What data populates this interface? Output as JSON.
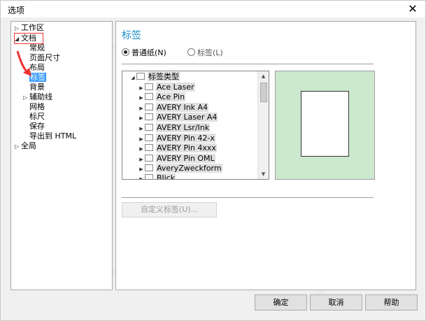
{
  "window": {
    "title": "选项",
    "close_glyph": "✕"
  },
  "tree": [
    {
      "expander": "▷",
      "label": "工作区"
    },
    {
      "expander": "◢",
      "label": "文档"
    },
    {
      "label": "常规"
    },
    {
      "label": "页面尺寸"
    },
    {
      "label": "布局"
    },
    {
      "label": "标签"
    },
    {
      "label": "背景"
    },
    {
      "expander": "▷",
      "label": "辅助线"
    },
    {
      "label": "网格"
    },
    {
      "label": "标尺"
    },
    {
      "label": "保存"
    },
    {
      "label": "导出到 HTML"
    },
    {
      "expander": "▷",
      "label": "全局"
    }
  ],
  "content": {
    "title": "标签",
    "radio_plain": "普通纸(N)",
    "radio_label": "标签(L)",
    "list_root": "标签类型",
    "list_items": [
      "Ace Laser",
      "Ace Pin",
      "AVERY Ink A4",
      "AVERY Laser A4",
      "AVERY Lsr/Ink",
      "AVERY Pin 42-x",
      "AVERY Pin 4xxx",
      "AVERY Pin OML",
      "AveryZweckform",
      "Blick"
    ],
    "custom_button": "自定义标签(U)..."
  },
  "buttons": {
    "ok": "确定",
    "cancel": "取消",
    "help": "帮助"
  },
  "colors": {
    "accent": "#1e90c8",
    "selection": "#3399ff",
    "highlight_box": "#ee3333",
    "preview_bg": "#cce8cf"
  }
}
